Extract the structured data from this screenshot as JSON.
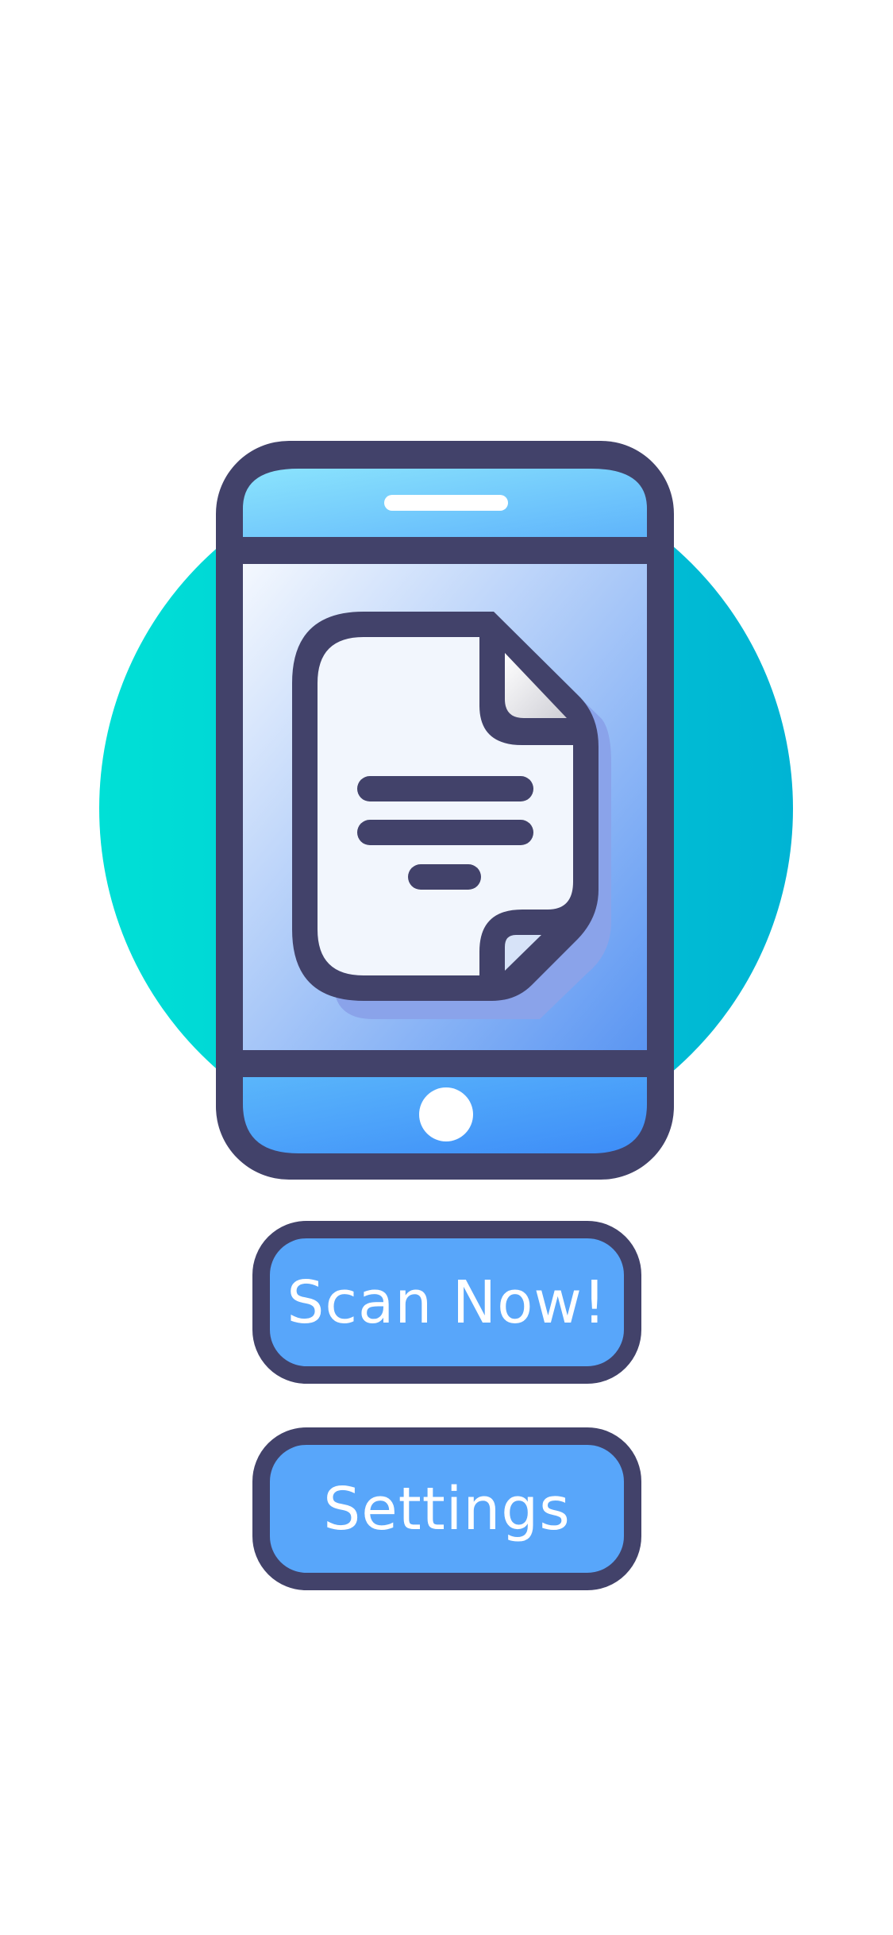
{
  "illustration": {
    "name": "phone-document-illustration",
    "colors": {
      "outline": "#42426a",
      "circle_start": "#00e0d6",
      "circle_end": "#00b4d4",
      "screen_light": "#f4f8fe",
      "screen_dark": "#5b96f2",
      "phone_top_start": "#8be4fd",
      "phone_top_end": "#5fb4fb",
      "phone_bottom_start": "#5ab6fb",
      "phone_bottom_end": "#3d8cf8",
      "document_fill": "#f2f6fd",
      "document_shadow": "#8aa3ea"
    }
  },
  "actions": {
    "scan_label": "Scan Now!",
    "settings_label": "Settings"
  }
}
